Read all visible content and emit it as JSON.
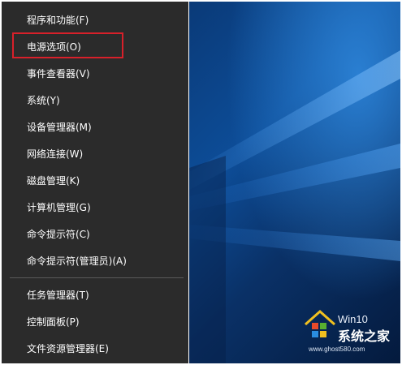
{
  "menu": {
    "items": [
      {
        "label": "程序和功能(F)"
      },
      {
        "label": "电源选项(O)"
      },
      {
        "label": "事件查看器(V)"
      },
      {
        "label": "系统(Y)"
      },
      {
        "label": "设备管理器(M)"
      },
      {
        "label": "网络连接(W)"
      },
      {
        "label": "磁盘管理(K)"
      },
      {
        "label": "计算机管理(G)"
      },
      {
        "label": "命令提示符(C)"
      },
      {
        "label": "命令提示符(管理员)(A)"
      },
      {
        "label": "任务管理器(T)"
      },
      {
        "label": "控制面板(P)"
      },
      {
        "label": "文件资源管理器(E)"
      }
    ],
    "highlighted_item": "电源选项(O)"
  },
  "watermark": {
    "line1": "Win10",
    "line2": "系统之家",
    "url": "www.ghost580.com"
  },
  "colors": {
    "menu_bg": "#2b2b2b",
    "highlight_border": "#d8202a",
    "desktop_blue": "#0d4d98"
  }
}
